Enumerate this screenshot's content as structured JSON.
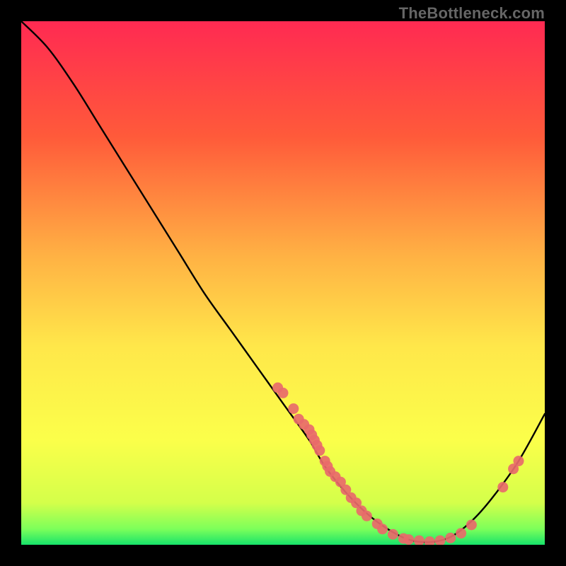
{
  "watermark": "TheBottleneck.com",
  "chart_data": {
    "type": "line",
    "title": "",
    "xlabel": "",
    "ylabel": "",
    "xlim": [
      0,
      100
    ],
    "ylim": [
      0,
      100
    ],
    "grid": false,
    "gradient_stops": [
      {
        "offset": 0,
        "color": "#ff2a52"
      },
      {
        "offset": 22,
        "color": "#ff5a3a"
      },
      {
        "offset": 45,
        "color": "#ffb244"
      },
      {
        "offset": 62,
        "color": "#ffe74a"
      },
      {
        "offset": 80,
        "color": "#fbff4a"
      },
      {
        "offset": 92,
        "color": "#d4ff4a"
      },
      {
        "offset": 97,
        "color": "#7cff5a"
      },
      {
        "offset": 100,
        "color": "#17e36a"
      }
    ],
    "series": [
      {
        "name": "curve",
        "x": [
          0,
          5,
          10,
          15,
          20,
          25,
          30,
          35,
          40,
          45,
          50,
          55,
          58,
          62,
          66,
          70,
          74,
          78,
          82,
          86,
          90,
          95,
          100
        ],
        "values": [
          100,
          95,
          88,
          80,
          72,
          64,
          56,
          48,
          41,
          34,
          27,
          20,
          15,
          10,
          6,
          3,
          1,
          0.5,
          1.5,
          4.5,
          9,
          16,
          25
        ]
      }
    ],
    "scatter_points": [
      {
        "x": 49,
        "y": 30
      },
      {
        "x": 50,
        "y": 29
      },
      {
        "x": 52,
        "y": 26
      },
      {
        "x": 53,
        "y": 24
      },
      {
        "x": 54,
        "y": 23
      },
      {
        "x": 55,
        "y": 22
      },
      {
        "x": 55.5,
        "y": 21
      },
      {
        "x": 56,
        "y": 20
      },
      {
        "x": 56.5,
        "y": 19
      },
      {
        "x": 57,
        "y": 18
      },
      {
        "x": 58,
        "y": 16
      },
      {
        "x": 58.5,
        "y": 15
      },
      {
        "x": 59,
        "y": 14
      },
      {
        "x": 60,
        "y": 13
      },
      {
        "x": 61,
        "y": 12
      },
      {
        "x": 62,
        "y": 10.5
      },
      {
        "x": 63,
        "y": 9
      },
      {
        "x": 64,
        "y": 8
      },
      {
        "x": 65,
        "y": 6.5
      },
      {
        "x": 66,
        "y": 5.5
      },
      {
        "x": 68,
        "y": 4
      },
      {
        "x": 69,
        "y": 3
      },
      {
        "x": 71,
        "y": 2
      },
      {
        "x": 73,
        "y": 1.2
      },
      {
        "x": 74,
        "y": 1
      },
      {
        "x": 76,
        "y": 0.8
      },
      {
        "x": 78,
        "y": 0.6
      },
      {
        "x": 80,
        "y": 0.8
      },
      {
        "x": 82,
        "y": 1.3
      },
      {
        "x": 84,
        "y": 2.2
      },
      {
        "x": 86,
        "y": 3.8
      },
      {
        "x": 92,
        "y": 11
      },
      {
        "x": 94,
        "y": 14.5
      },
      {
        "x": 95,
        "y": 16
      }
    ],
    "marker_color": "#e86a6a",
    "curve_color": "#000000",
    "curve_width": 2.4
  }
}
